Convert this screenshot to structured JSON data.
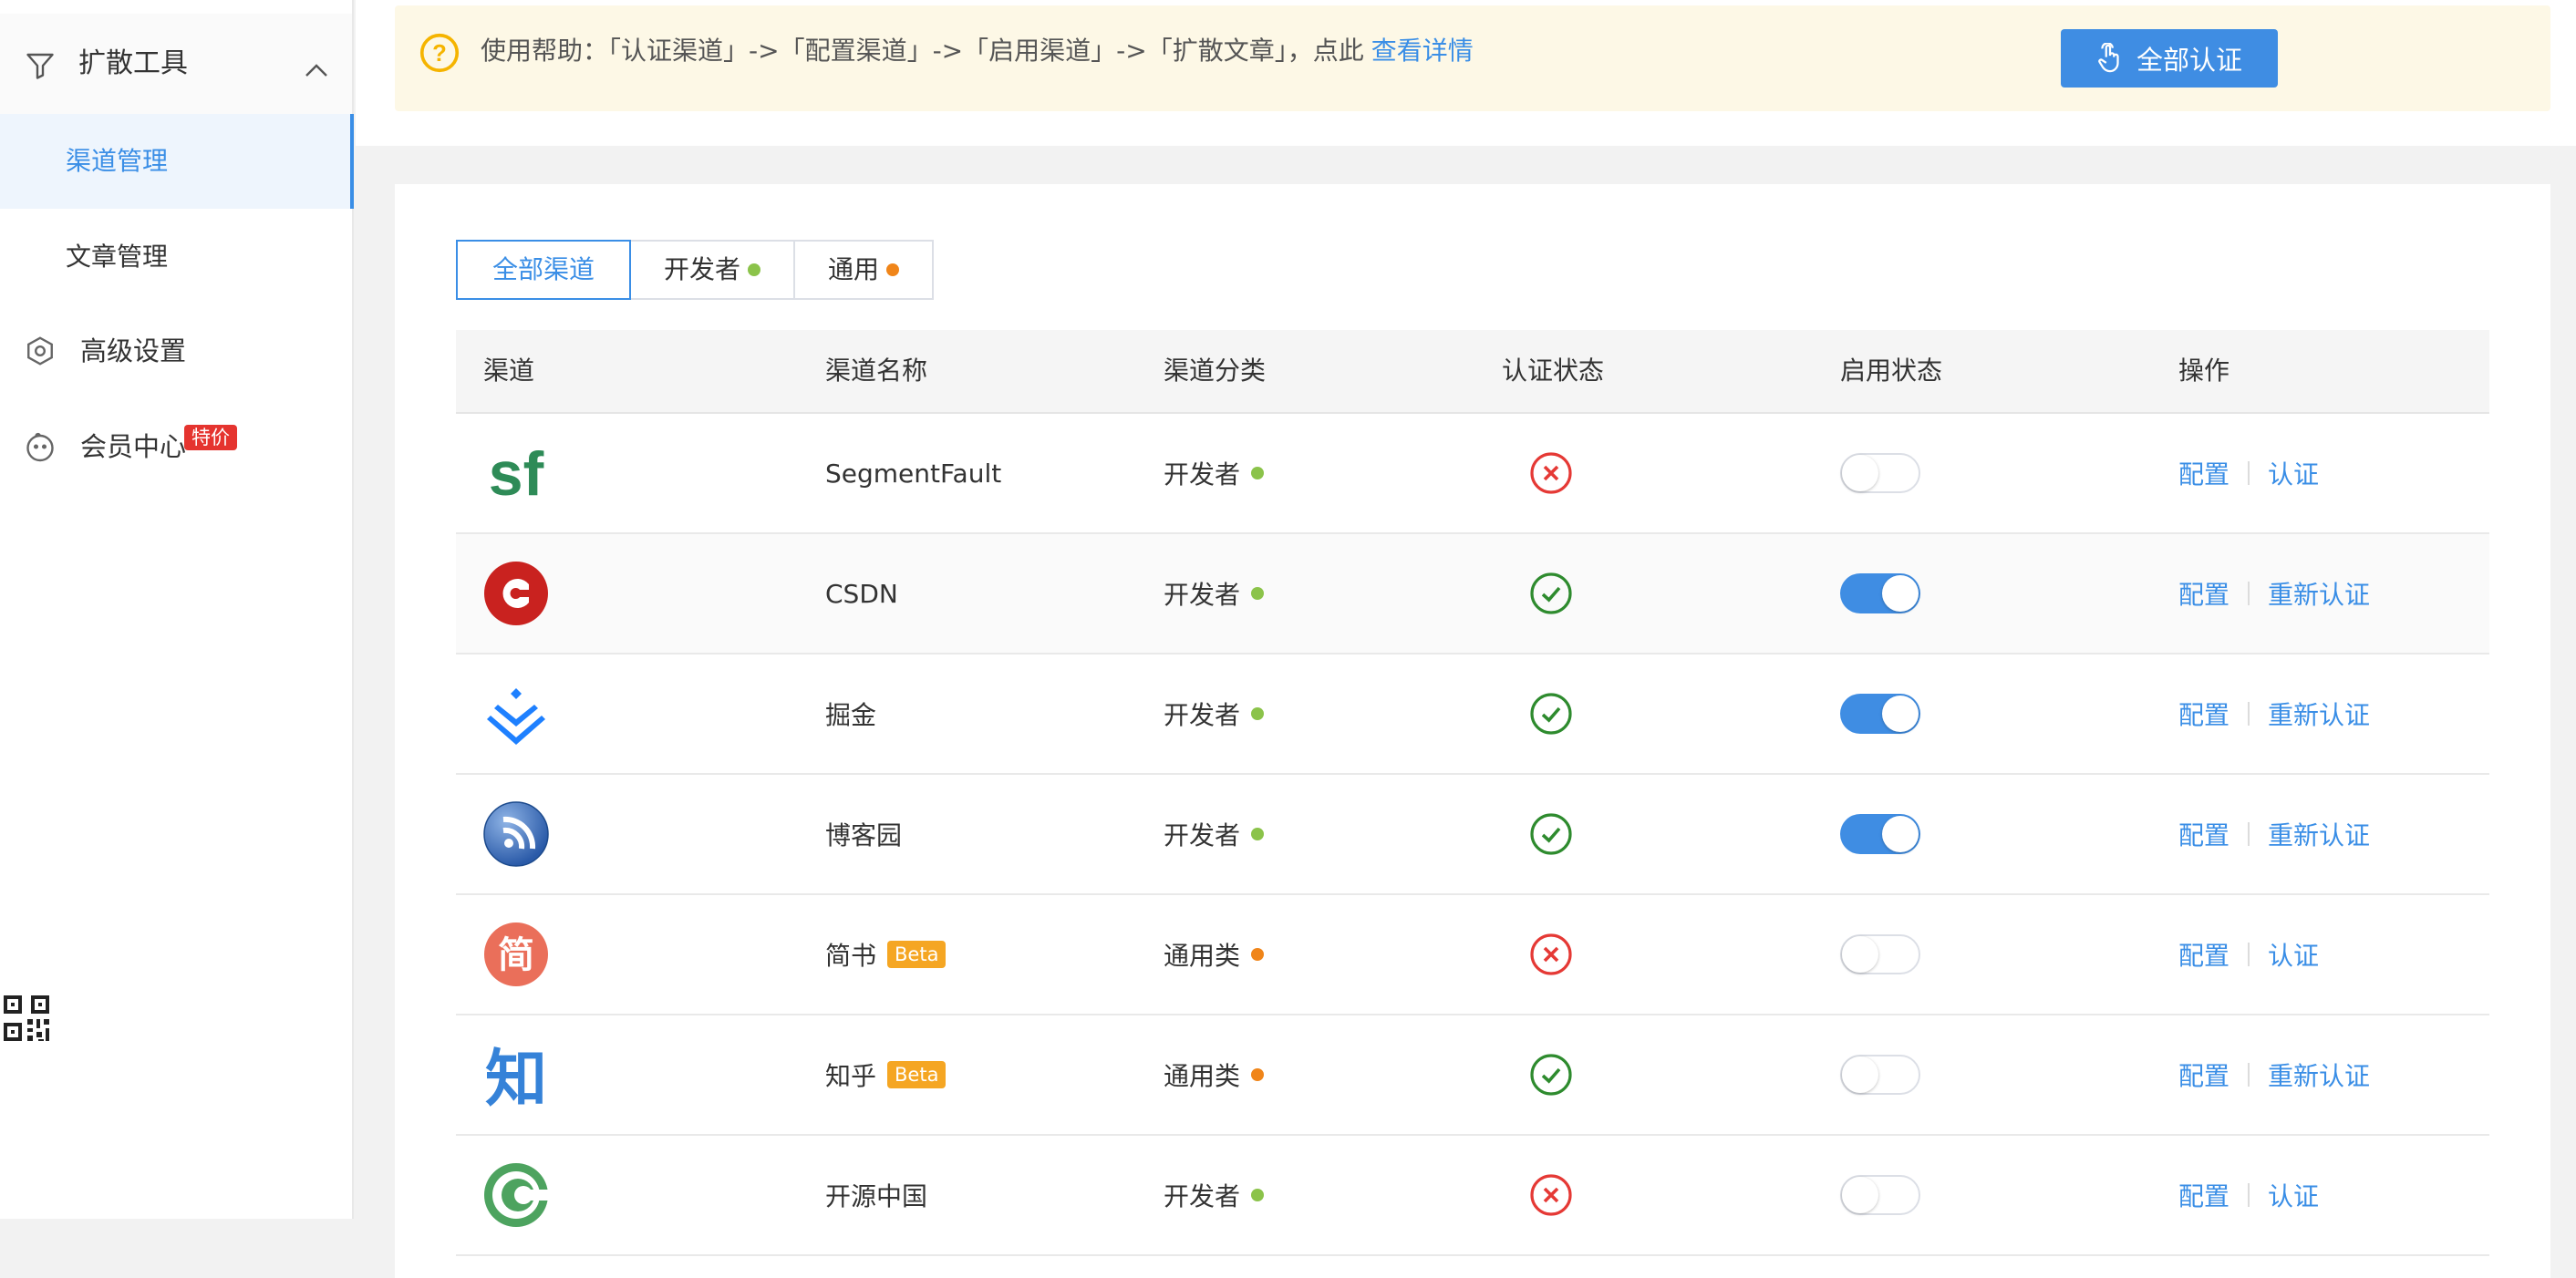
{
  "sidebar": {
    "group_label": "扩散工具",
    "sub_items": [
      {
        "label": "渠道管理",
        "active": true
      },
      {
        "label": "文章管理",
        "active": false
      }
    ],
    "advanced_label": "高级设置",
    "member_label": "会员中心",
    "member_badge": "特价"
  },
  "banner": {
    "help_text": "使用帮助：「认证渠道」->「配置渠道」->「启用渠道」->「扩散文章」，点此",
    "help_link": "查看详情",
    "button_label": "全部认证"
  },
  "tabs": [
    {
      "label": "全部渠道",
      "active": true
    },
    {
      "label": "开发者",
      "dot_color": "#8bc34a"
    },
    {
      "label": "通用",
      "dot_color": "#f08519"
    }
  ],
  "table": {
    "headers": [
      "渠道",
      "渠道名称",
      "渠道分类",
      "认证状态",
      "启用状态",
      "操作"
    ],
    "rows": [
      {
        "logo": "segmentfault-logo",
        "name": "SegmentFault",
        "beta": "",
        "category": "开发者",
        "category_dot": "#8bc34a",
        "authenticated": false,
        "enabled": false,
        "op_config": "配置",
        "op_auth": "认证"
      },
      {
        "logo": "csdn-logo",
        "name": "CSDN",
        "beta": "",
        "category": "开发者",
        "category_dot": "#8bc34a",
        "authenticated": true,
        "enabled": true,
        "op_config": "配置",
        "op_auth": "重新认证"
      },
      {
        "logo": "juejin-logo",
        "name": "掘金",
        "beta": "",
        "category": "开发者",
        "category_dot": "#8bc34a",
        "authenticated": true,
        "enabled": true,
        "op_config": "配置",
        "op_auth": "重新认证"
      },
      {
        "logo": "cnblogs-logo",
        "name": "博客园",
        "beta": "",
        "category": "开发者",
        "category_dot": "#8bc34a",
        "authenticated": true,
        "enabled": true,
        "op_config": "配置",
        "op_auth": "重新认证"
      },
      {
        "logo": "jianshu-logo",
        "name": "简书",
        "beta": "Beta",
        "category": "通用类",
        "category_dot": "#f08519",
        "authenticated": false,
        "enabled": false,
        "op_config": "配置",
        "op_auth": "认证"
      },
      {
        "logo": "zhihu-logo",
        "name": "知乎",
        "beta": "Beta",
        "category": "通用类",
        "category_dot": "#f08519",
        "authenticated": true,
        "enabled": false,
        "op_config": "配置",
        "op_auth": "重新认证"
      },
      {
        "logo": "oschina-logo",
        "name": "开源中国",
        "beta": "",
        "category": "开发者",
        "category_dot": "#8bc34a",
        "authenticated": false,
        "enabled": false,
        "op_config": "配置",
        "op_auth": "认证"
      }
    ]
  },
  "logo_text": {
    "segmentfault": "sf",
    "jianshu": "简",
    "zhihu": "知"
  },
  "colors": {
    "accent": "#3a8ee6",
    "success": "#2e8b2e",
    "error": "#e53935",
    "dev_dot": "#8bc34a",
    "general_dot": "#f08519"
  }
}
